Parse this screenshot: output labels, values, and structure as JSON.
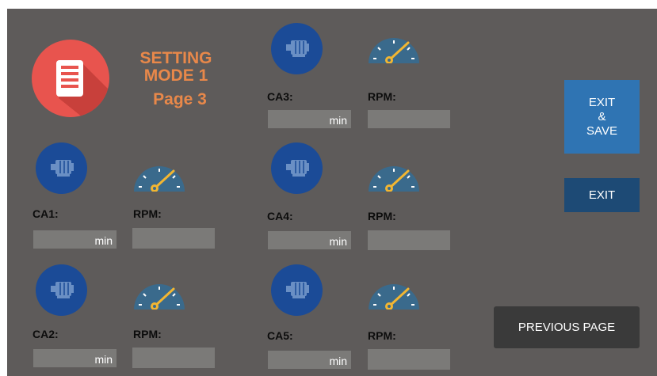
{
  "header": {
    "title_line1": "SETTING",
    "title_line2": "MODE 1",
    "page_label": "Page 3"
  },
  "icons": {
    "document": "document-icon",
    "motor": "motor-icon",
    "gauge": "gauge-icon"
  },
  "channels": [
    {
      "label": "CA1:",
      "unit": "min",
      "rpm_label": "RPM:"
    },
    {
      "label": "CA2:",
      "unit": "min",
      "rpm_label": "RPM:"
    },
    {
      "label": "CA3:",
      "unit": "min",
      "rpm_label": "RPM:"
    },
    {
      "label": "CA4:",
      "unit": "min",
      "rpm_label": "RPM:"
    },
    {
      "label": "CA5:",
      "unit": "min",
      "rpm_label": "RPM:"
    }
  ],
  "buttons": {
    "exit_save": [
      "EXIT",
      "&",
      "SAVE"
    ],
    "exit": "EXIT",
    "previous_page": "PREVIOUS PAGE"
  },
  "colors": {
    "background": "#5e5b5a",
    "title_orange": "#e8884a",
    "doc_red": "#e8544e",
    "motor_blue": "#1b4b97",
    "gauge_body": "#3a6a8c",
    "needle_yellow": "#f2b632",
    "exit_save_blue": "#2f74b3",
    "exit_blue": "#1d4a75",
    "prev_page_dark": "#3a3a3a",
    "field_gray": "#7b7a78"
  }
}
